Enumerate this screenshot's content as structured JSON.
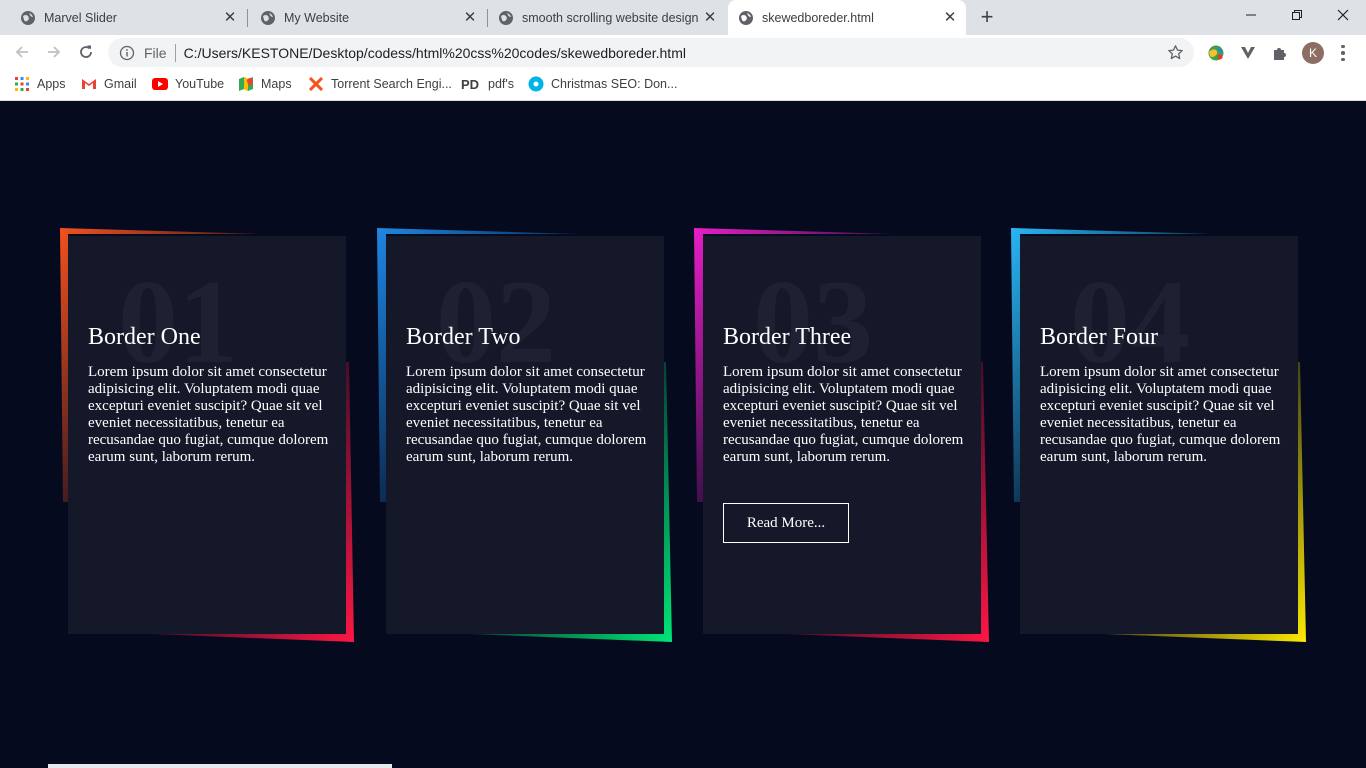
{
  "browser": {
    "tabs": [
      {
        "title": "Marvel Slider",
        "active": false
      },
      {
        "title": "My Website",
        "active": false
      },
      {
        "title": "smooth scrolling website design",
        "active": false
      },
      {
        "title": "skewedboreder.html",
        "active": true
      }
    ],
    "omnibox": {
      "scheme": "File",
      "url": "C:/Users/KESTONE/Desktop/codess/html%20css%20codes/skewedboreder.html"
    },
    "profile_initial": "K",
    "bookmarks": [
      {
        "label": "Apps",
        "icon": "apps-grid-icon"
      },
      {
        "label": "Gmail",
        "icon": "gmail-icon"
      },
      {
        "label": "YouTube",
        "icon": "youtube-icon"
      },
      {
        "label": "Maps",
        "icon": "maps-icon"
      },
      {
        "label": "Torrent Search Engi...",
        "icon": "torrent-icon"
      },
      {
        "label": "pdf's",
        "icon": "pdf-icon"
      },
      {
        "label": "Christmas SEO: Don...",
        "icon": "circle-site-icon"
      }
    ]
  },
  "cards": [
    {
      "number": "01",
      "title": "Border One",
      "text": "Lorem ipsum dolor sit amet consectetur adipisicing elit. Voluptatem modi quae excepturi eveniet suscipit? Quae sit vel eveniet necessitatibus, tenetur ea recusandae quo fugiat, cumque dolorem earum sunt, laborum rerum.",
      "colors": [
        "#f4511e",
        "#ff1744"
      ]
    },
    {
      "number": "02",
      "title": "Border Two",
      "text": "Lorem ipsum dolor sit amet consectetur adipisicing elit. Voluptatem modi quae excepturi eveniet suscipit? Quae sit vel eveniet necessitatibus, tenetur ea recusandae quo fugiat, cumque dolorem earum sunt, laborum rerum.",
      "colors": [
        "#1e88e5",
        "#00e676"
      ]
    },
    {
      "number": "03",
      "title": "Border Three",
      "text": "Lorem ipsum dolor sit amet consectetur adipisicing elit. Voluptatem modi quae excepturi eveniet suscipit? Quae sit vel eveniet necessitatibus, tenetur ea recusandae quo fugiat, cumque dolorem earum sunt, laborum rerum.",
      "button": "Read More...",
      "colors": [
        "#e91ec8",
        "#ff1744"
      ]
    },
    {
      "number": "04",
      "title": "Border Four",
      "text": "Lorem ipsum dolor sit amet consectetur adipisicing elit. Voluptatem modi quae excepturi eveniet suscipit? Quae sit vel eveniet necessitatibus, tenetur ea recusandae quo fugiat, cumque dolorem earum sunt, laborum rerum.",
      "colors": [
        "#29b6f6",
        "#ffea00"
      ]
    }
  ],
  "colors": {
    "page_background": "#050a1f",
    "card_background": "#141829"
  }
}
